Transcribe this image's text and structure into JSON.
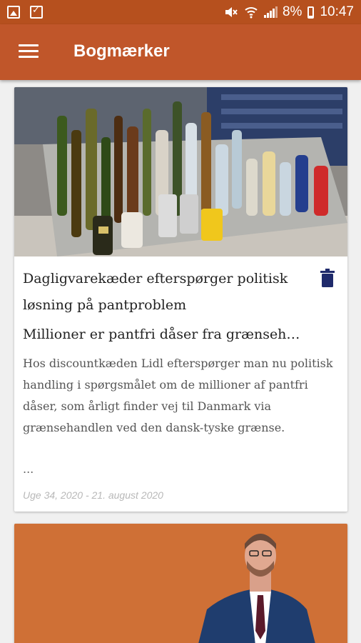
{
  "status_bar": {
    "battery": "8%",
    "time": "10:47"
  },
  "app_bar": {
    "title": "Bogmærker"
  },
  "articles": [
    {
      "headline": "Dagligvarekæder efterspørger politisk løsning på pantproblem",
      "subheadline": "Millioner er pantfri dåser fra grænseh…",
      "body": "Hos discountkæden Lidl efterspørger man nu politisk handling i spørgsmålet om de millioner af pantfri dåser, som årligt finder vej til Danmark via grænsehandlen ved den dansk-tyske grænse.",
      "ellipsis": "...",
      "date": "Uge 34, 2020 - 21. august 2020"
    },
    {}
  ],
  "colors": {
    "status_bar": "#b6501e",
    "app_bar": "#c0562a",
    "delete_icon": "#1f2a6b",
    "date_text": "#b8b8b8"
  }
}
